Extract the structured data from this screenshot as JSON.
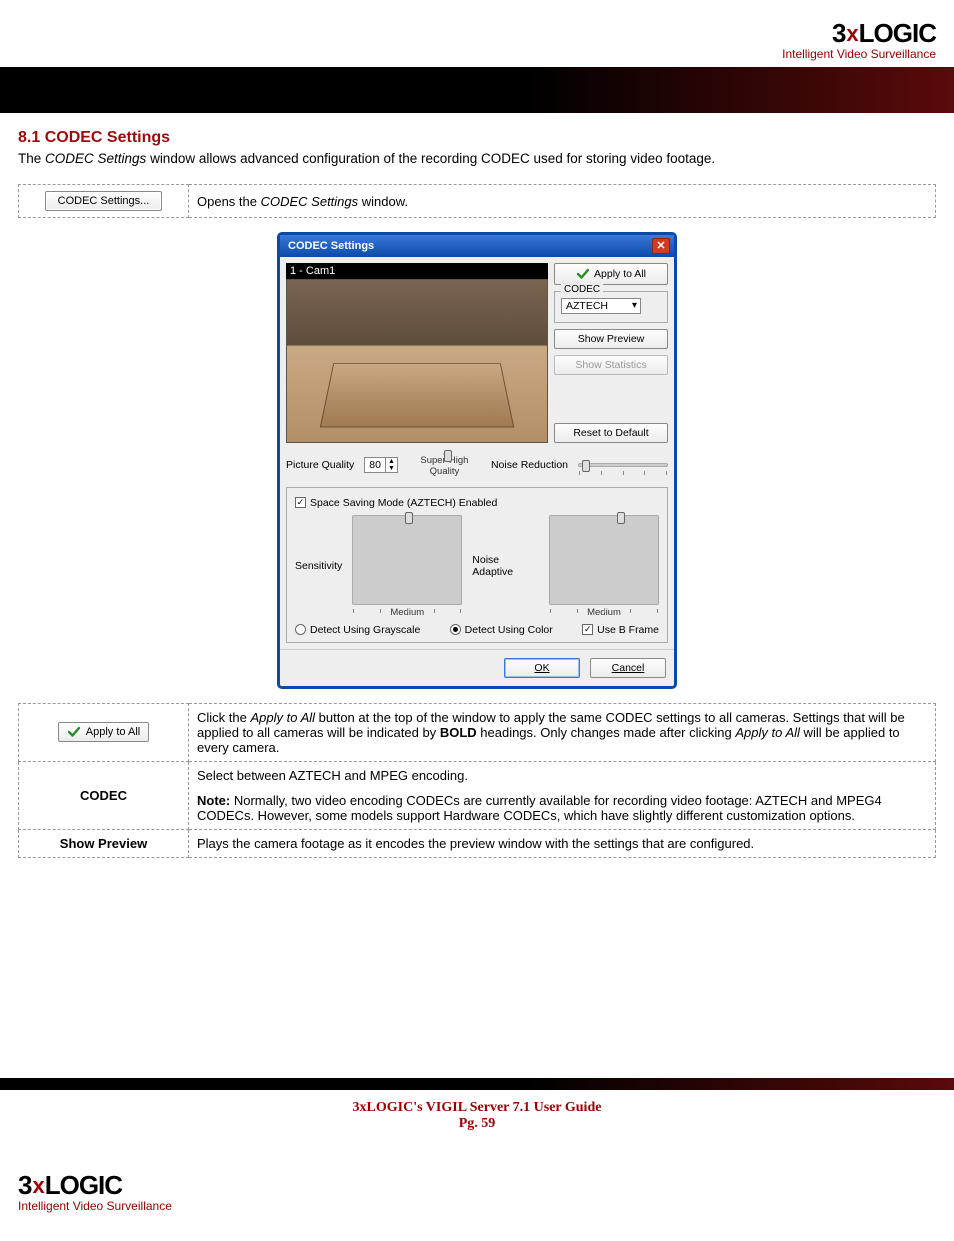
{
  "brand": {
    "logo_three": "3",
    "logo_x": "x",
    "logo_logic": "LOGIC",
    "tagline": "Intelligent Video Surveillance"
  },
  "section": {
    "title": "8.1 CODEC Settings",
    "intro_pre": "The ",
    "intro_ital": "CODEC Settings",
    "intro_post": " window allows advanced configuration of the recording CODEC used for storing video footage."
  },
  "table1": {
    "btn_label": "CODEC Settings...",
    "desc_pre": "Opens the ",
    "desc_ital": "CODEC Settings",
    "desc_post": " window."
  },
  "win": {
    "title": "CODEC Settings",
    "preview_label": "1 - Cam1",
    "apply_all": "Apply to All",
    "codec_group_label": "CODEC",
    "codec_value": "AZTECH",
    "show_preview": "Show Preview",
    "show_statistics": "Show Statistics",
    "reset_default": "Reset to Default",
    "picture_quality_label": "Picture Quality",
    "picture_quality_value": "80",
    "picture_quality_caption": "Super-High Quality",
    "noise_reduction_label": "Noise Reduction",
    "space_saving": "Space Saving Mode (AZTECH) Enabled",
    "sensitivity_label": "Sensitivity",
    "sensitivity_caption": "Medium",
    "noise_adaptive_label": "Noise Adaptive",
    "noise_adaptive_caption": "Medium",
    "detect_grayscale": "Detect Using Grayscale",
    "detect_color": "Detect Using Color",
    "use_b_frame": "Use B Frame",
    "ok": "OK",
    "cancel": "Cancel"
  },
  "table2": {
    "rows": [
      {
        "label_is_button": true,
        "btn_label": "Apply to All",
        "desc_parts": {
          "p1": "Click the ",
          "i1": "Apply to All",
          "p2": " button at the top of the window to apply the same CODEC settings to all cameras. Settings that will be applied to all cameras will be indicated by ",
          "b1": "BOLD",
          "p3": " headings. ",
          "p4": "Only changes made after clicking ",
          "i2": "Apply to All",
          "p5": " will be applied to every camera."
        }
      },
      {
        "label_text": "CODEC",
        "desc_line1": "Select between AZTECH and MPEG encoding.",
        "note_label": "Note:",
        "note_text": " Normally, two video encoding CODECs are currently available for recording video footage: AZTECH and MPEG4 CODECs. However, some models support Hardware CODECs, which have slightly different customization options."
      },
      {
        "label_text": "Show Preview",
        "desc_line1": "Plays the camera footage as it encodes the preview window with the settings that are configured."
      }
    ]
  },
  "footer": {
    "line1": "3xLOGIC's VIGIL Server 7.1 User Guide",
    "line2": "Pg. 59"
  }
}
